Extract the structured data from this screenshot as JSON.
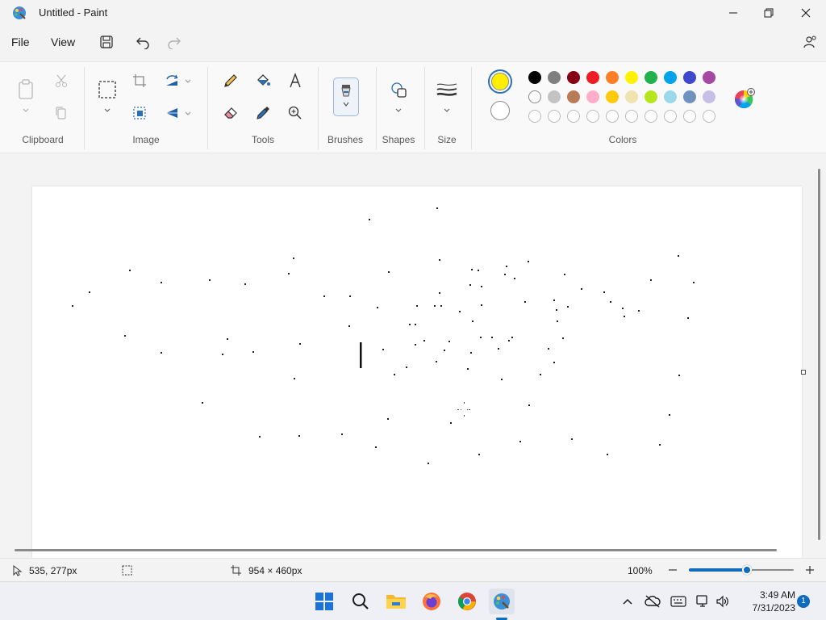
{
  "window": {
    "title": "Untitled - Paint"
  },
  "menu": {
    "file": "File",
    "view": "View"
  },
  "ribbon": {
    "groups": {
      "clipboard": "Clipboard",
      "image": "Image",
      "tools": "Tools",
      "brushes": "Brushes",
      "shapes": "Shapes",
      "size": "Size",
      "colors": "Colors"
    },
    "primary_color": "#ffee00",
    "secondary_color": "#ffffff",
    "palette_row1": [
      "#000000",
      "#7f7f7f",
      "#880015",
      "#ed1c24",
      "#ff7f27",
      "#fff200",
      "#22b14c",
      "#00a2e8",
      "#3f48cc",
      "#a349a4"
    ],
    "palette_row2": [
      "#ffffff",
      "#c3c3c3",
      "#b97a57",
      "#ffaec9",
      "#ffc90e",
      "#efe4b0",
      "#b5e61d",
      "#99d9ea",
      "#7092be",
      "#c8bfe7"
    ]
  },
  "status": {
    "cursor_position": "535, 277px",
    "canvas_size": "954 × 460px",
    "zoom": "100%",
    "zoom_level": 0.55
  },
  "taskbar": {
    "time": "3:49 AM",
    "date": "7/31/2023",
    "notification_count": "1"
  }
}
